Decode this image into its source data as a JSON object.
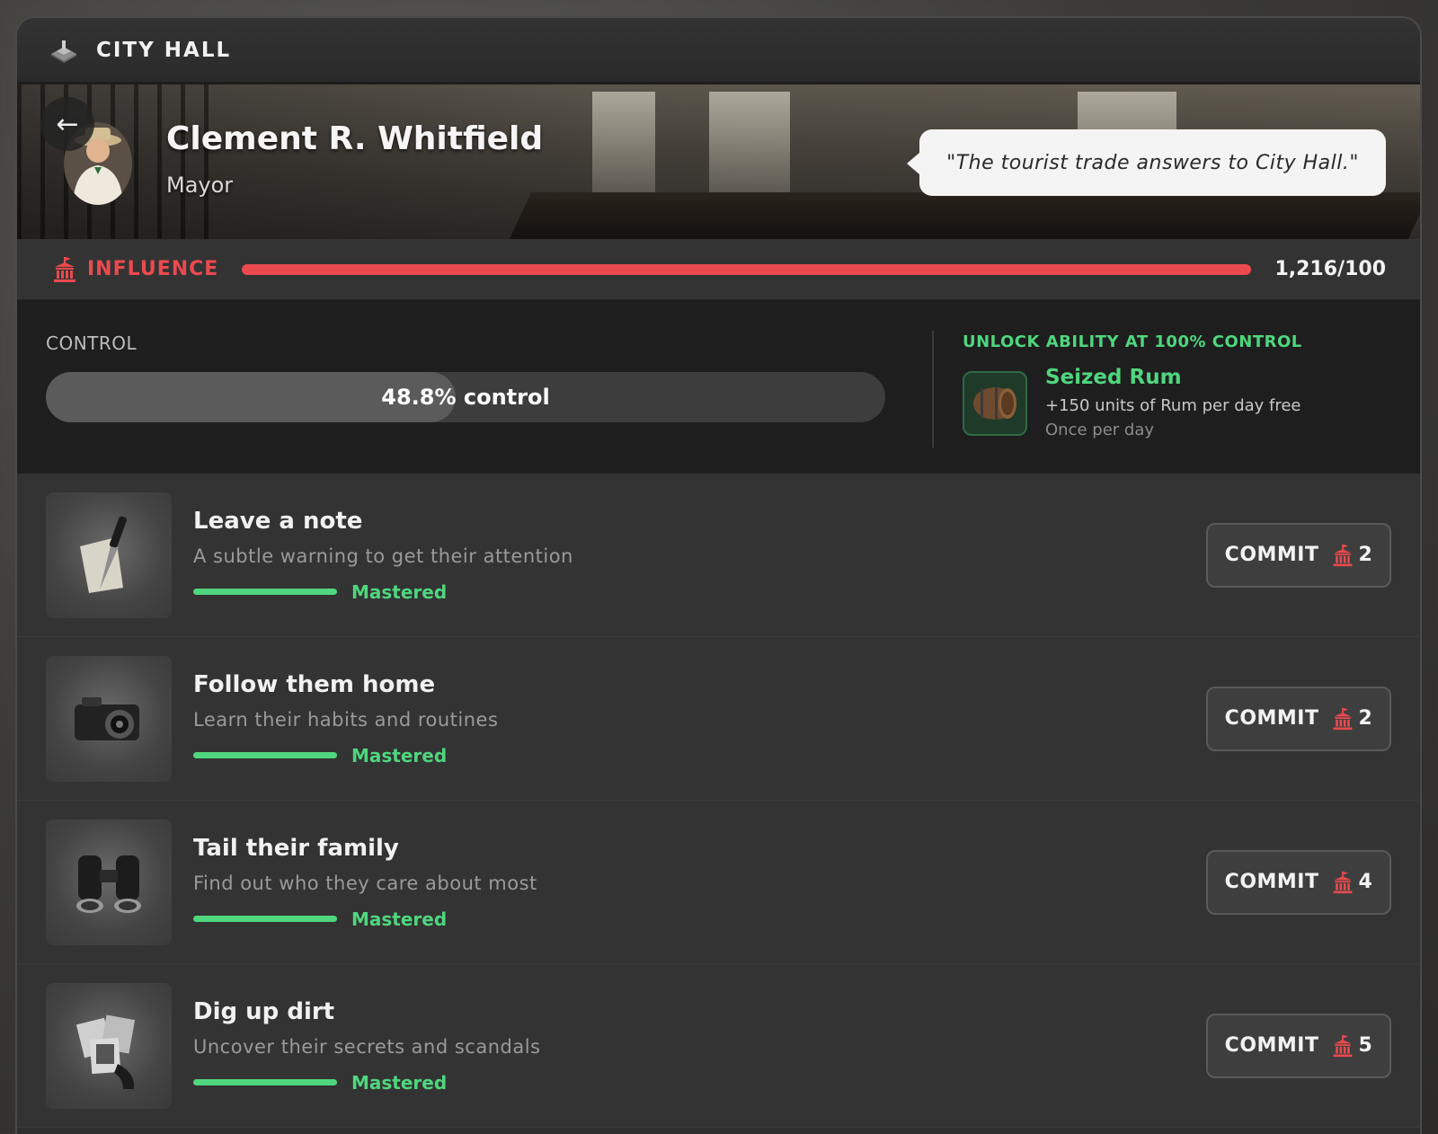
{
  "window": {
    "title": "CITY HALL",
    "icon": "city-hall-icon"
  },
  "hero": {
    "name": "Clement R. Whitfield",
    "role": "Mayor",
    "quote": "\"The tourist trade answers to City Hall.\"",
    "back_icon": "back-arrow-icon"
  },
  "influence": {
    "label": "INFLUENCE",
    "value": "1,216/100",
    "fill_fraction": 1.0,
    "color": "#ea4a4e",
    "icon": "capitol-icon"
  },
  "control": {
    "label": "CONTROL",
    "percent": 48.8,
    "text": "48.8% control",
    "unlock_title": "UNLOCK ABILITY AT 100% CONTROL",
    "ability": {
      "name": "Seized Rum",
      "description": "+150 units of Rum per day free",
      "frequency": "Once per day",
      "icon": "rum-barrel-icon"
    }
  },
  "actions": [
    {
      "name": "Leave a note",
      "description": "A subtle warning to get their attention",
      "status": "Mastered",
      "mastery": 1.0,
      "commit_label": "COMMIT",
      "cost": "2",
      "icon": "knife-note-icon"
    },
    {
      "name": "Follow them home",
      "description": "Learn their habits and routines",
      "status": "Mastered",
      "mastery": 1.0,
      "commit_label": "COMMIT",
      "cost": "2",
      "icon": "camera-icon"
    },
    {
      "name": "Tail their family",
      "description": "Find out who they care about most",
      "status": "Mastered",
      "mastery": 1.0,
      "commit_label": "COMMIT",
      "cost": "4",
      "icon": "binoculars-icon"
    },
    {
      "name": "Dig up dirt",
      "description": "Uncover their secrets and scandals",
      "status": "Mastered",
      "mastery": 1.0,
      "commit_label": "COMMIT",
      "cost": "5",
      "icon": "photos-icon"
    }
  ],
  "colors": {
    "accent_green": "#4fd67e",
    "accent_red": "#ea4a4e",
    "panel": "#333333"
  }
}
